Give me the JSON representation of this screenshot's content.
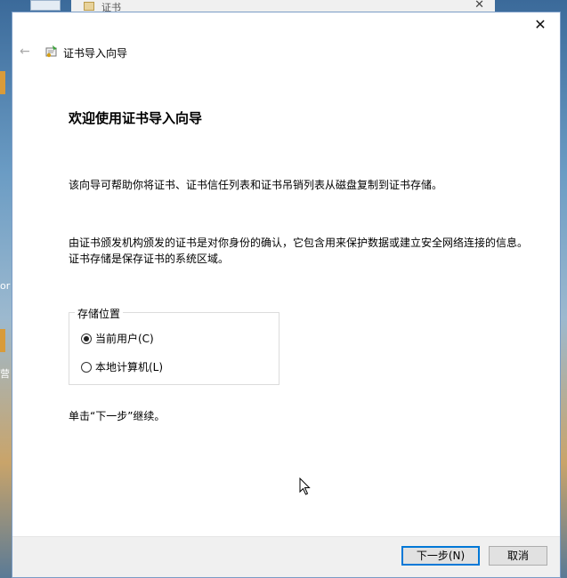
{
  "background": {
    "window_title": "证书",
    "desktop_labels": [
      "or",
      "营"
    ]
  },
  "dialog": {
    "header_title": "证书导入向导",
    "heading": "欢迎使用证书导入向导",
    "paragraph1": "该向导可帮助你将证书、证书信任列表和证书吊销列表从磁盘复制到证书存储。",
    "paragraph2": "由证书颁发机构颁发的证书是对你身份的确认，它包含用来保护数据或建立安全网络连接的信息。证书存储是保存证书的系统区域。",
    "store_location": {
      "legend": "存储位置",
      "options": [
        {
          "label": "当前用户(C)",
          "checked": true
        },
        {
          "label": "本地计算机(L)",
          "checked": false
        }
      ]
    },
    "instruction": "单击“下一步”继续。",
    "buttons": {
      "next": "下一步(N)",
      "cancel": "取消"
    },
    "colors": {
      "accent": "#0078d7",
      "border": "#7a9cc6"
    }
  }
}
